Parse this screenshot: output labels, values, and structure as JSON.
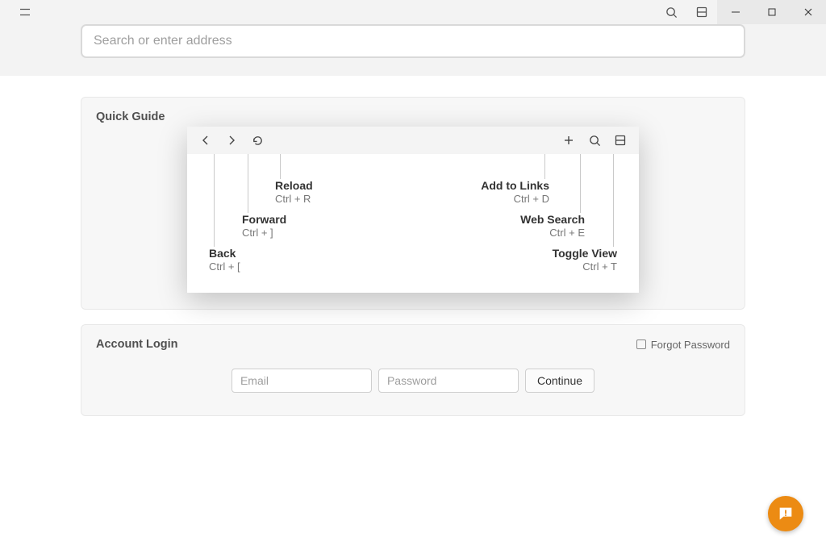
{
  "addressbar": {
    "placeholder": "Search or enter address"
  },
  "panels": {
    "quickguide": {
      "title": "Quick Guide",
      "hints": {
        "back": {
          "label": "Back",
          "shortcut": "Ctrl + ["
        },
        "forward": {
          "label": "Forward",
          "shortcut": "Ctrl + ]"
        },
        "reload": {
          "label": "Reload",
          "shortcut": "Ctrl + R"
        },
        "add": {
          "label": "Add to Links",
          "shortcut": "Ctrl + D"
        },
        "search": {
          "label": "Web Search",
          "shortcut": "Ctrl + E"
        },
        "toggle": {
          "label": "Toggle View",
          "shortcut": "Ctrl + T"
        }
      }
    },
    "login": {
      "title": "Account Login",
      "forgot": "Forgot Password",
      "email_placeholder": "Email",
      "password_placeholder": "Password",
      "continue": "Continue"
    }
  }
}
